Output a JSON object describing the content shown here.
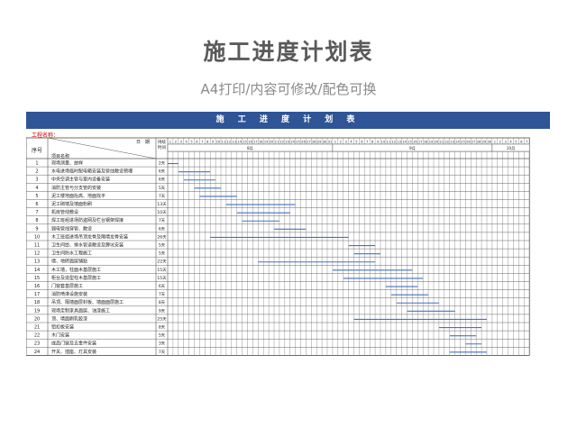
{
  "page": {
    "title": "施工进度计划表",
    "subtitle": "A4打印/内容可修改/配色可换"
  },
  "sheet": {
    "banner": "施 工 进 度 计 划 表",
    "project_label": "工程名称：",
    "header": {
      "seq": "序号",
      "date": "日　期",
      "item": "项目名称",
      "duration": "持续时间"
    },
    "day_numbers": [
      1,
      2,
      3,
      4,
      5,
      6,
      7,
      8,
      9,
      10,
      11,
      12,
      13,
      14,
      15,
      16,
      17,
      18,
      19,
      20,
      21,
      22,
      23,
      24,
      25,
      26,
      27,
      28,
      29,
      30,
      31,
      1,
      2,
      3,
      4,
      5,
      6,
      7,
      8,
      9,
      10,
      11,
      12,
      13,
      14,
      15,
      16,
      17,
      18,
      19,
      20,
      21,
      22,
      23,
      24,
      25,
      26,
      27,
      28,
      29,
      30,
      1,
      2,
      3,
      4,
      5,
      6,
      7
    ],
    "months": [
      {
        "label": "8月",
        "days": 31
      },
      {
        "label": "9月",
        "days": 30
      },
      {
        "label": "10月",
        "days": 7
      }
    ],
    "bar_color": "#4472c4",
    "tasks": [
      {
        "no": "1",
        "name": "现场测量、放样",
        "duration": "2天",
        "start": 1,
        "days": 2
      },
      {
        "no": "2",
        "name": "水电进场临时配电箱安装及管线敷设预埋",
        "duration": "6天",
        "start": 3,
        "days": 6
      },
      {
        "no": "3",
        "name": "中央空调主管与室内设备安装",
        "duration": "6天",
        "start": 4,
        "days": 6
      },
      {
        "no": "4",
        "name": "消防主管与分支管的安装",
        "duration": "5天",
        "start": 6,
        "days": 5
      },
      {
        "no": "5",
        "name": "泥工楼地面抬高、地面找平",
        "duration": "7天",
        "start": 7,
        "days": 7
      },
      {
        "no": "6",
        "name": "泥工砌墙及墙面粉刷",
        "duration": "13天",
        "start": 12,
        "days": 13
      },
      {
        "no": "7",
        "name": "机房管线敷设",
        "duration": "10天",
        "start": 14,
        "days": 10
      },
      {
        "no": "8",
        "name": "焊工班组进场防盗网及栏台钢架焊接",
        "duration": "7天",
        "start": 15,
        "days": 7
      },
      {
        "no": "9",
        "name": "弱电管线穿管、敷设",
        "duration": "6天",
        "start": 21,
        "days": 6
      },
      {
        "no": "10",
        "name": "木工班组进场吊顶龙骨及隔墙龙骨安装",
        "duration": "26天",
        "start": 9,
        "days": 26
      },
      {
        "no": "11",
        "name": "卫生间给、排水管道敷设及蹲坑安装",
        "duration": "5天",
        "start": 35,
        "days": 5
      },
      {
        "no": "12",
        "name": "卫生间防水工程施工",
        "duration": "5天",
        "start": 36,
        "days": 5
      },
      {
        "no": "13",
        "name": "墙、地砖面层铺贴",
        "duration": "22天",
        "start": 18,
        "days": 22
      },
      {
        "no": "14",
        "name": "木工墙，柱面木基层施工",
        "duration": "15天",
        "start": 32,
        "days": 15
      },
      {
        "no": "15",
        "name": "柜台及造型柱木基层施工",
        "duration": "15天",
        "start": 34,
        "days": 15
      },
      {
        "no": "16",
        "name": "门窗套基层施工",
        "duration": "6天",
        "start": 42,
        "days": 6
      },
      {
        "no": "17",
        "name": "消防喷淋设施安装",
        "duration": "7天",
        "start": 43,
        "days": 7
      },
      {
        "no": "18",
        "name": "吊顶、隔墙面层封板、墙面面层施工",
        "duration": "8天",
        "start": 44,
        "days": 8
      },
      {
        "no": "19",
        "name": "现场定制家具面层、油漆施工",
        "duration": "9天",
        "start": 46,
        "days": 9
      },
      {
        "no": "20",
        "name": "顶、墙面刷乳胶漆",
        "duration": "25天",
        "start": 36,
        "days": 25
      },
      {
        "no": "21",
        "name": "铝扣板安装",
        "duration": "8天",
        "start": 52,
        "days": 8
      },
      {
        "no": "22",
        "name": "木门安装",
        "duration": "5天",
        "start": 54,
        "days": 5
      },
      {
        "no": "23",
        "name": "成品门窗及五金件安装",
        "duration": "3天",
        "start": 57,
        "days": 3
      },
      {
        "no": "24",
        "name": "开关、插座、灯具安装",
        "duration": "7天",
        "start": 54,
        "days": 7
      }
    ]
  }
}
